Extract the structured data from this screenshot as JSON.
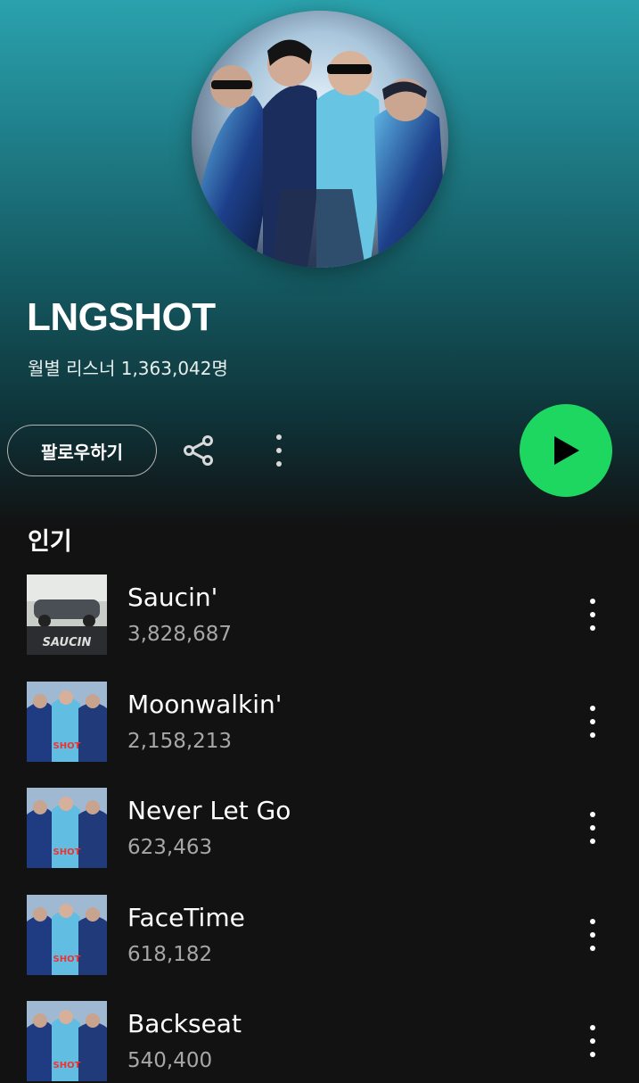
{
  "artist": {
    "name": "LNGSHOT",
    "monthly_listeners": "월별 리스너 1,363,042명"
  },
  "actions": {
    "follow_label": "팔로우하기",
    "share_icon": "share-icon",
    "more_icon": "more-vertical-icon",
    "play_icon": "play-icon",
    "play_color": "#1ed760"
  },
  "popular": {
    "title": "인기",
    "tracks": [
      {
        "title": "Saucin'",
        "plays": "3,828,687"
      },
      {
        "title": "Moonwalkin'",
        "plays": "2,158,213"
      },
      {
        "title": "Never Let Go",
        "plays": "623,463"
      },
      {
        "title": "FaceTime",
        "plays": "618,182"
      },
      {
        "title": "Backseat",
        "plays": "540,400"
      }
    ]
  },
  "colors": {
    "header_gradient_top": "#2aa2ad",
    "background": "#121212",
    "secondary_text": "#a7a7a7"
  }
}
